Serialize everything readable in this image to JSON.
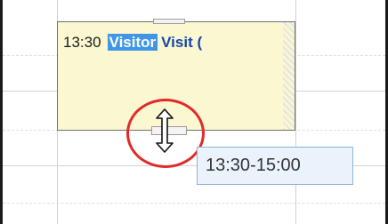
{
  "event": {
    "time": "13:30",
    "highlighted_word": "Visitor",
    "title": "Visit (",
    "background_color": "#fbf7d1",
    "highlight_color": "#3f96e6"
  },
  "cursor": {
    "icon": "vertical-resize-cursor-icon"
  },
  "highlight_ring": {
    "color": "#e12a2a"
  },
  "tooltip": {
    "text": "13:30-15:00"
  }
}
